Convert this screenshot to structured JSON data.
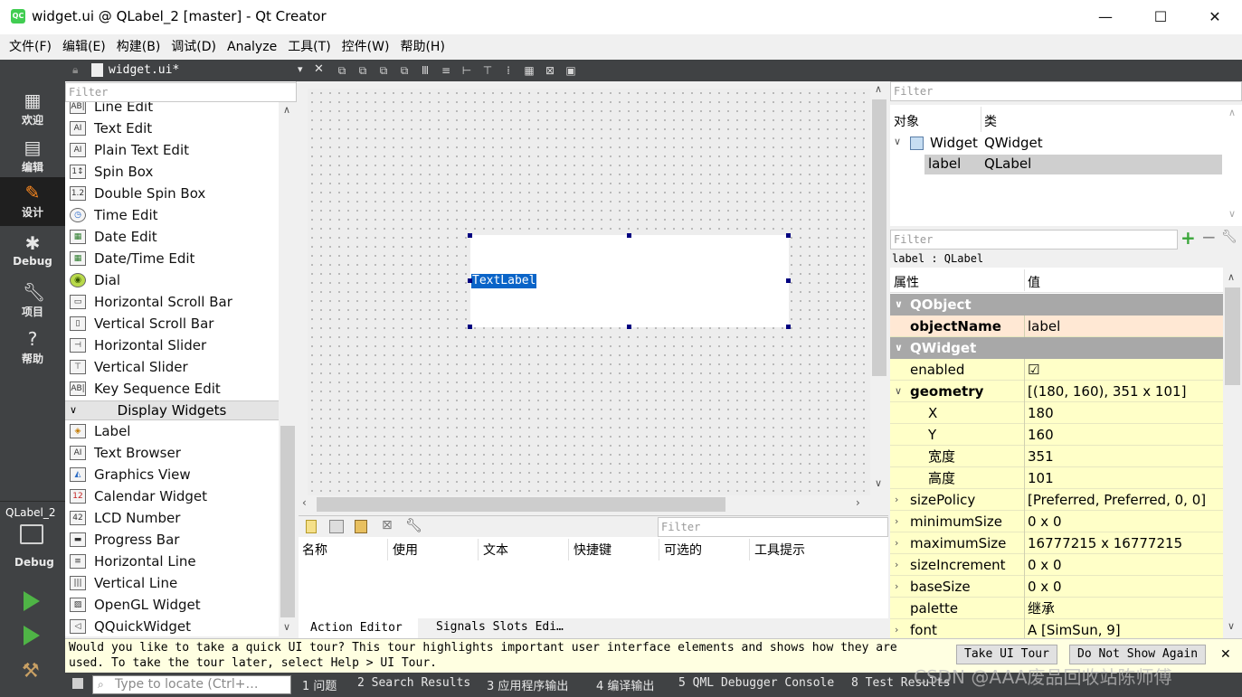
{
  "window": {
    "title": "widget.ui @ QLabel_2 [master] - Qt Creator",
    "app_icon_text": "QC",
    "minimize": "—",
    "maximize": "☐",
    "close": "✕"
  },
  "menu": [
    "文件(F)",
    "编辑(E)",
    "构建(B)",
    "调试(D)",
    "Analyze",
    "工具(T)",
    "控件(W)",
    "帮助(H)"
  ],
  "modes": [
    {
      "label": "欢迎",
      "icon": "grid-icon"
    },
    {
      "label": "编辑",
      "icon": "document-icon"
    },
    {
      "label": "设计",
      "icon": "pencil-icon"
    },
    {
      "label": "Debug",
      "icon": "bug-icon"
    },
    {
      "label": "项目",
      "icon": "wrench-icon"
    },
    {
      "label": "帮助",
      "icon": "question-icon"
    }
  ],
  "kit": {
    "project": "QLabel_2",
    "config": "Debug"
  },
  "document": {
    "name": "widget.ui*"
  },
  "widget_box": {
    "filter_placeholder": "Filter",
    "items_top": [
      {
        "label": "Line Edit",
        "icon": "AB|"
      },
      {
        "label": "Text Edit",
        "icon": "AI"
      },
      {
        "label": "Plain Text Edit",
        "icon": "AI"
      },
      {
        "label": "Spin Box",
        "icon": "1↕"
      },
      {
        "label": "Double Spin Box",
        "icon": "1.2"
      },
      {
        "label": "Time Edit",
        "icon": "◷"
      },
      {
        "label": "Date Edit",
        "icon": "▦"
      },
      {
        "label": "Date/Time Edit",
        "icon": "▦"
      },
      {
        "label": "Dial",
        "icon": "◉"
      },
      {
        "label": "Horizontal Scroll Bar",
        "icon": "▭"
      },
      {
        "label": "Vertical Scroll Bar",
        "icon": "▯"
      },
      {
        "label": "Horizontal Slider",
        "icon": "⊣"
      },
      {
        "label": "Vertical Slider",
        "icon": "⊤"
      },
      {
        "label": "Key Sequence Edit",
        "icon": "AB|"
      }
    ],
    "category": "Display Widgets",
    "items_bottom": [
      {
        "label": "Label",
        "icon": "◈"
      },
      {
        "label": "Text Browser",
        "icon": "AI"
      },
      {
        "label": "Graphics View",
        "icon": "◭"
      },
      {
        "label": "Calendar Widget",
        "icon": "12"
      },
      {
        "label": "LCD Number",
        "icon": "42"
      },
      {
        "label": "Progress Bar",
        "icon": "▬"
      },
      {
        "label": "Horizontal Line",
        "icon": "≡"
      },
      {
        "label": "Vertical Line",
        "icon": "|||"
      },
      {
        "label": "OpenGL Widget",
        "icon": "▨"
      },
      {
        "label": "QQuickWidget",
        "icon": "◁"
      }
    ]
  },
  "canvas": {
    "label_text": "TextLabel"
  },
  "action_editor": {
    "filter_placeholder": "Filter",
    "columns": [
      "名称",
      "使用",
      "文本",
      "快捷键",
      "可选的",
      "工具提示"
    ],
    "tabs": [
      "Action Editor",
      "Signals Slots Edi…"
    ]
  },
  "object_inspector": {
    "filter_placeholder": "Filter",
    "col_object": "对象",
    "col_class": "类",
    "rows": [
      {
        "object": "Widget",
        "class": "QWidget"
      },
      {
        "object": "label",
        "class": "QLabel"
      }
    ]
  },
  "property_editor": {
    "filter_placeholder": "Filter",
    "context": "label : QLabel",
    "col_property": "属性",
    "col_value": "值",
    "rows": [
      {
        "name": "QObject",
        "value": "",
        "kind": "section",
        "expander": "∨"
      },
      {
        "name": "objectName",
        "value": "label",
        "kind": "peach",
        "bold": true
      },
      {
        "name": "QWidget",
        "value": "",
        "kind": "section",
        "expander": "∨"
      },
      {
        "name": "enabled",
        "value": "☑",
        "kind": "yellow"
      },
      {
        "name": "geometry",
        "value": "[(180, 160), 351 x 101]",
        "kind": "yellow",
        "bold": true,
        "expander": "∨"
      },
      {
        "name": "X",
        "value": "180",
        "kind": "yellow",
        "indent": true
      },
      {
        "name": "Y",
        "value": "160",
        "kind": "yellow",
        "indent": true
      },
      {
        "name": "宽度",
        "value": "351",
        "kind": "yellow",
        "indent": true
      },
      {
        "name": "高度",
        "value": "101",
        "kind": "yellow",
        "indent": true
      },
      {
        "name": "sizePolicy",
        "value": "[Preferred, Preferred, 0, 0]",
        "kind": "yellow",
        "expander": "›"
      },
      {
        "name": "minimumSize",
        "value": "0 x 0",
        "kind": "yellow",
        "expander": "›"
      },
      {
        "name": "maximumSize",
        "value": "16777215 x 16777215",
        "kind": "yellow",
        "expander": "›"
      },
      {
        "name": "sizeIncrement",
        "value": "0 x 0",
        "kind": "yellow",
        "expander": "›"
      },
      {
        "name": "baseSize",
        "value": "0 x 0",
        "kind": "yellow",
        "expander": "›"
      },
      {
        "name": "palette",
        "value": "继承",
        "kind": "yellow"
      },
      {
        "name": "font",
        "value": "A  [SimSun, 9]",
        "kind": "yellow",
        "expander": "›"
      }
    ]
  },
  "notification": {
    "line1": "Would you like to take a quick UI tour? This tour highlights important user interface elements and shows how they are",
    "line2": "used. To take the tour later, select Help > UI Tour.",
    "take_tour": "Take UI Tour",
    "dont_show": "Do Not Show Again",
    "close": "✕"
  },
  "output": {
    "locator_placeholder": "Type to locate (Ctrl+…",
    "tabs": [
      "1 问题",
      "2 Search Results",
      "3 应用程序输出",
      "4 编译输出",
      "5 QML Debugger Console",
      "8 Test Results"
    ]
  },
  "watermark": "CSDN @AAA废品回收站陈师傅"
}
